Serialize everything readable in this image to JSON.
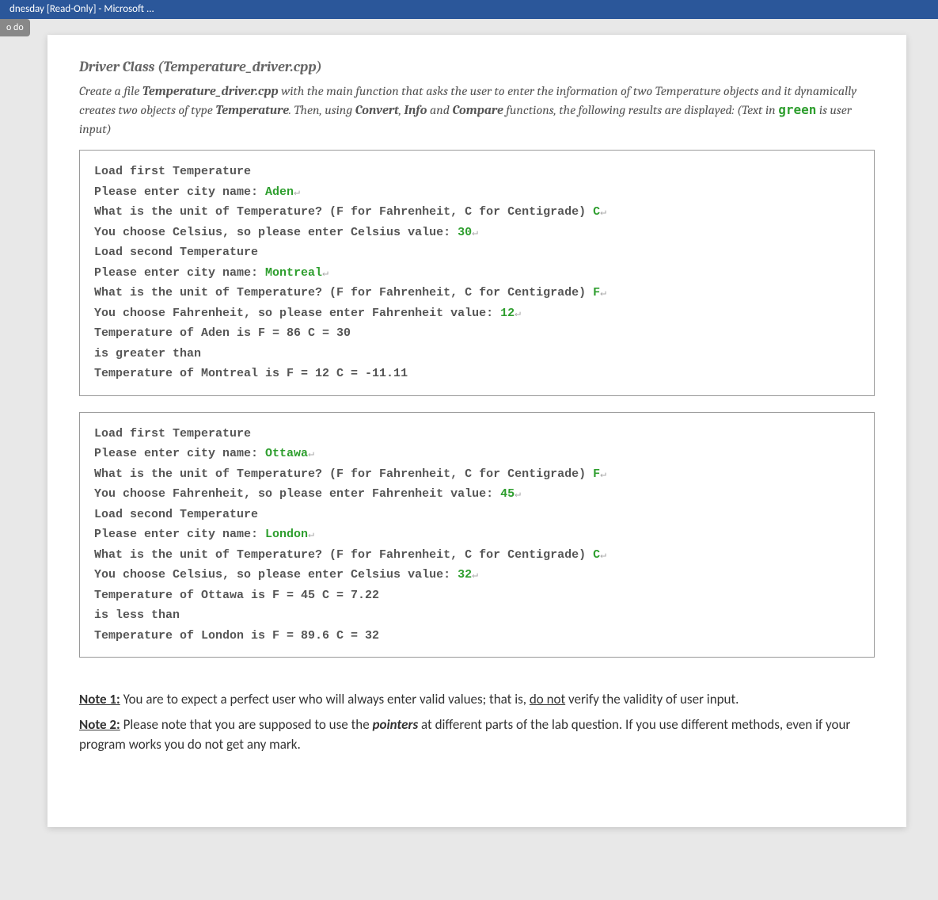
{
  "window": {
    "title_fragment": "dnesday [Read-Only] - Microsoft ..."
  },
  "sidebar_tab": "o do",
  "section_title": "Driver Class (Temperature_driver.cpp)",
  "intro": {
    "line1a": "Create a file ",
    "file": "Temperature_driver.cpp",
    "line1b": " with the main function that asks the user to enter the information of two Temperature objects and it dynamically creates two objects of type ",
    "type": "Temperature",
    "line1c": ". Then, using ",
    "fn1": "Convert",
    "sep1": ", ",
    "fn2": "Info",
    "and": " and ",
    "fn3": "Compare",
    "line1d": " functions, the following results are displayed: (Text in ",
    "green_word": "green",
    "line1e": " is user input)"
  },
  "box1": {
    "l1": "Load first Temperature",
    "l2a": "Please enter city name: ",
    "l2g": "Aden",
    "l3a": "What is the unit of Temperature? (F for Fahrenheit, C for Centigrade) ",
    "l3g": "C",
    "l4a": "You choose Celsius, so please enter Celsius value: ",
    "l4g": "30",
    "l5": "Load second Temperature",
    "l6a": "Please enter city name: ",
    "l6g": "Montreal",
    "l7a": "What is the unit of Temperature? (F for Fahrenheit, C for Centigrade) ",
    "l7g": "F",
    "l8a": "You choose Fahrenheit, so please enter Fahrenheit value: ",
    "l8g": "12",
    "l9": "Temperature of Aden is F = 86 C = 30",
    "l10": "is greater than",
    "l11": "Temperature of Montreal is F = 12 C = -11.11"
  },
  "box2": {
    "l1": "Load first Temperature",
    "l2a": "Please enter city name: ",
    "l2g": "Ottawa",
    "l3a": "What is the unit of Temperature? (F for Fahrenheit, C for Centigrade) ",
    "l3g": "F",
    "l4a": "You choose Fahrenheit, so please enter Fahrenheit value: ",
    "l4g": "45",
    "l5": "Load second Temperature",
    "l6a": "Please enter city name: ",
    "l6g": "London",
    "l7a": "What is the unit of Temperature? (F for Fahrenheit, C for Centigrade) ",
    "l7g": "C",
    "l8a": "You choose Celsius, so please enter Celsius value: ",
    "l8g": "32",
    "l9": "Temperature of Ottawa is F = 45 C = 7.22",
    "l10": "is less than",
    "l11": "Temperature of London is F = 89.6 C = 32"
  },
  "notes": {
    "n1_label": "Note 1:",
    "n1a": " You are to expect a perfect user who will always enter valid values; that is, ",
    "n1_ul": "do not",
    "n1b": " verify the validity of user input.",
    "n2_label": "Note 2:",
    "n2a": " Please note that you are supposed to use the ",
    "n2_bi": "pointers",
    "n2b": " at different parts of the lab question. If you use different methods, even if your program works you do not get any mark."
  }
}
